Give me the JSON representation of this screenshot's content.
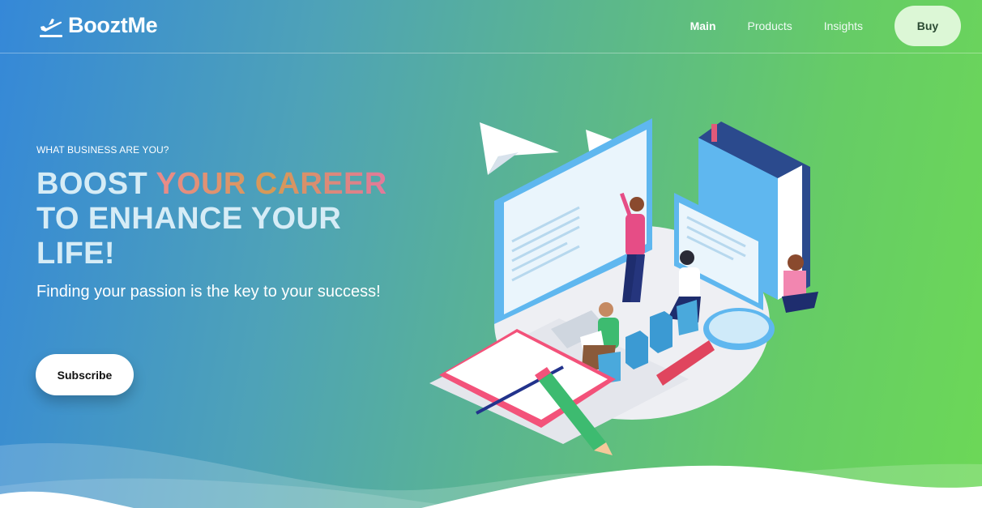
{
  "nav": {
    "brand": "BooztMe",
    "logo_icon": "plane-takeoff-icon",
    "links": [
      "Main",
      "Products",
      "Insights"
    ],
    "active": "Main",
    "buy_label": "Buy"
  },
  "hero": {
    "eyebrow": "WHAT BUSINESS ARE YOU?",
    "headline_start": "BOOST ",
    "headline_highlight": "YOUR CAREER",
    "headline_end": " TO ENHANCE YOUR LIFE!",
    "tagline": "Finding your passion is the key to your success!",
    "cta_label": "Subscribe"
  },
  "illustration": {
    "subject": "isometric-learning-illustration"
  },
  "colors": {
    "gradient_start": "#3588d8",
    "gradient_end": "#6cd857",
    "buy_bg": "#dcf7d6",
    "headline_text": "#d6ecf6"
  }
}
